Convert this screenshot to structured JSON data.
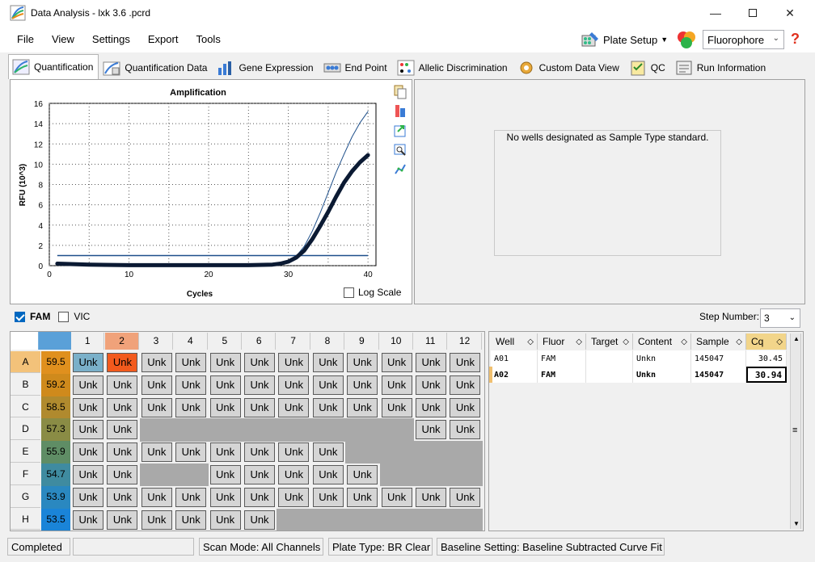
{
  "window": {
    "title": "Data Analysis - lxk 3.6 .pcrd"
  },
  "menu": [
    "File",
    "View",
    "Settings",
    "Export",
    "Tools"
  ],
  "toolbar": {
    "plate_setup": "Plate Setup",
    "fluorophore": "Fluorophore"
  },
  "tabs": [
    "Quantification",
    "Quantification Data",
    "Gene Expression",
    "End Point",
    "Allelic Discrimination",
    "Custom Data View",
    "QC",
    "Run Information"
  ],
  "chart_data": {
    "type": "line",
    "title": "Amplification",
    "xlabel": "Cycles",
    "ylabel": "RFU (10^3)",
    "xlim": [
      0,
      41
    ],
    "ylim": [
      0,
      16
    ],
    "xticks": [
      0,
      10,
      20,
      30,
      40
    ],
    "yticks": [
      0,
      2,
      4,
      6,
      8,
      10,
      12,
      14,
      16
    ],
    "threshold": 1.0,
    "series": [
      {
        "x": [
          1,
          5,
          10,
          15,
          20,
          25,
          28,
          29,
          30,
          31,
          32,
          33,
          34,
          35,
          36,
          37,
          38,
          39,
          40
        ],
        "y": [
          0.2,
          0.1,
          0.05,
          0.05,
          0.05,
          0.05,
          0.1,
          0.2,
          0.45,
          0.95,
          1.9,
          3.4,
          5.2,
          7.2,
          9.2,
          11.0,
          12.7,
          14.1,
          15.2
        ],
        "color": "#1e4f8a",
        "width": 1
      },
      {
        "x": [
          1,
          5,
          10,
          15,
          20,
          25,
          28,
          29,
          30,
          31,
          32,
          33,
          34,
          35,
          36,
          37,
          38,
          39,
          40
        ],
        "y": [
          0.2,
          0.1,
          0.05,
          0.05,
          0.05,
          0.05,
          0.1,
          0.2,
          0.4,
          0.8,
          1.5,
          2.6,
          3.9,
          5.3,
          6.8,
          8.2,
          9.3,
          10.2,
          10.9
        ],
        "color": "#0b1a33",
        "width": 5
      }
    ]
  },
  "chart_options": {
    "log_scale": "Log Scale"
  },
  "right_pane": {
    "message": "No wells designated as Sample Type standard."
  },
  "fluor_filters": [
    {
      "label": "FAM",
      "checked": true
    },
    {
      "label": "VIC",
      "checked": false
    }
  ],
  "step": {
    "label": "Step Number:",
    "value": "3"
  },
  "plate": {
    "columns": [
      "1",
      "2",
      "3",
      "4",
      "5",
      "6",
      "7",
      "8",
      "9",
      "10",
      "11",
      "12"
    ],
    "rows": [
      {
        "label": "A",
        "temp": "59.5",
        "wells": [
          "Unk",
          "Unk",
          "Unk",
          "Unk",
          "Unk",
          "Unk",
          "Unk",
          "Unk",
          "Unk",
          "Unk",
          "Unk",
          "Unk"
        ]
      },
      {
        "label": "B",
        "temp": "59.2",
        "wells": [
          "Unk",
          "Unk",
          "Unk",
          "Unk",
          "Unk",
          "Unk",
          "Unk",
          "Unk",
          "Unk",
          "Unk",
          "Unk",
          "Unk"
        ]
      },
      {
        "label": "C",
        "temp": "58.5",
        "wells": [
          "Unk",
          "Unk",
          "Unk",
          "Unk",
          "Unk",
          "Unk",
          "Unk",
          "Unk",
          "Unk",
          "Unk",
          "Unk",
          "Unk"
        ]
      },
      {
        "label": "D",
        "temp": "57.3",
        "wells": [
          "Unk",
          "Unk",
          "",
          "",
          "",
          "",
          "",
          "",
          "",
          "",
          "Unk",
          "Unk"
        ]
      },
      {
        "label": "E",
        "temp": "55.9",
        "wells": [
          "Unk",
          "Unk",
          "Unk",
          "Unk",
          "Unk",
          "Unk",
          "Unk",
          "Unk",
          "",
          "",
          "",
          ""
        ]
      },
      {
        "label": "F",
        "temp": "54.7",
        "wells": [
          "Unk",
          "Unk",
          "",
          "",
          "Unk",
          "Unk",
          "Unk",
          "Unk",
          "Unk",
          "",
          "",
          ""
        ]
      },
      {
        "label": "G",
        "temp": "53.9",
        "wells": [
          "Unk",
          "Unk",
          "Unk",
          "Unk",
          "Unk",
          "Unk",
          "Unk",
          "Unk",
          "Unk",
          "Unk",
          "Unk",
          "Unk"
        ]
      },
      {
        "label": "H",
        "temp": "53.5",
        "wells": [
          "Unk",
          "Unk",
          "Unk",
          "Unk",
          "Unk",
          "Unk",
          "",
          "",
          "",
          "",
          "",
          ""
        ]
      }
    ],
    "temp_colors": [
      "#e0901e",
      "#cf8a1c",
      "#b08a2e",
      "#8a8c45",
      "#5f8d65",
      "#3f8ba0",
      "#2a88c0",
      "#1a84d8"
    ]
  },
  "results": {
    "headers": [
      "Well",
      "Fluor",
      "Target",
      "Content",
      "Sample",
      "Cq"
    ],
    "rows": [
      {
        "well": "A01",
        "fluor": "FAM",
        "target": "",
        "content": "Unkn",
        "sample": "145047",
        "cq": "30.45"
      },
      {
        "well": "A02",
        "fluor": "FAM",
        "target": "",
        "content": "Unkn",
        "sample": "145047",
        "cq": "30.94"
      }
    ]
  },
  "status": {
    "state": "Completed",
    "scan_mode": "Scan Mode: All Channels",
    "plate_type": "Plate Type: BR Clear",
    "baseline": "Baseline Setting: Baseline Subtracted Curve Fit"
  }
}
